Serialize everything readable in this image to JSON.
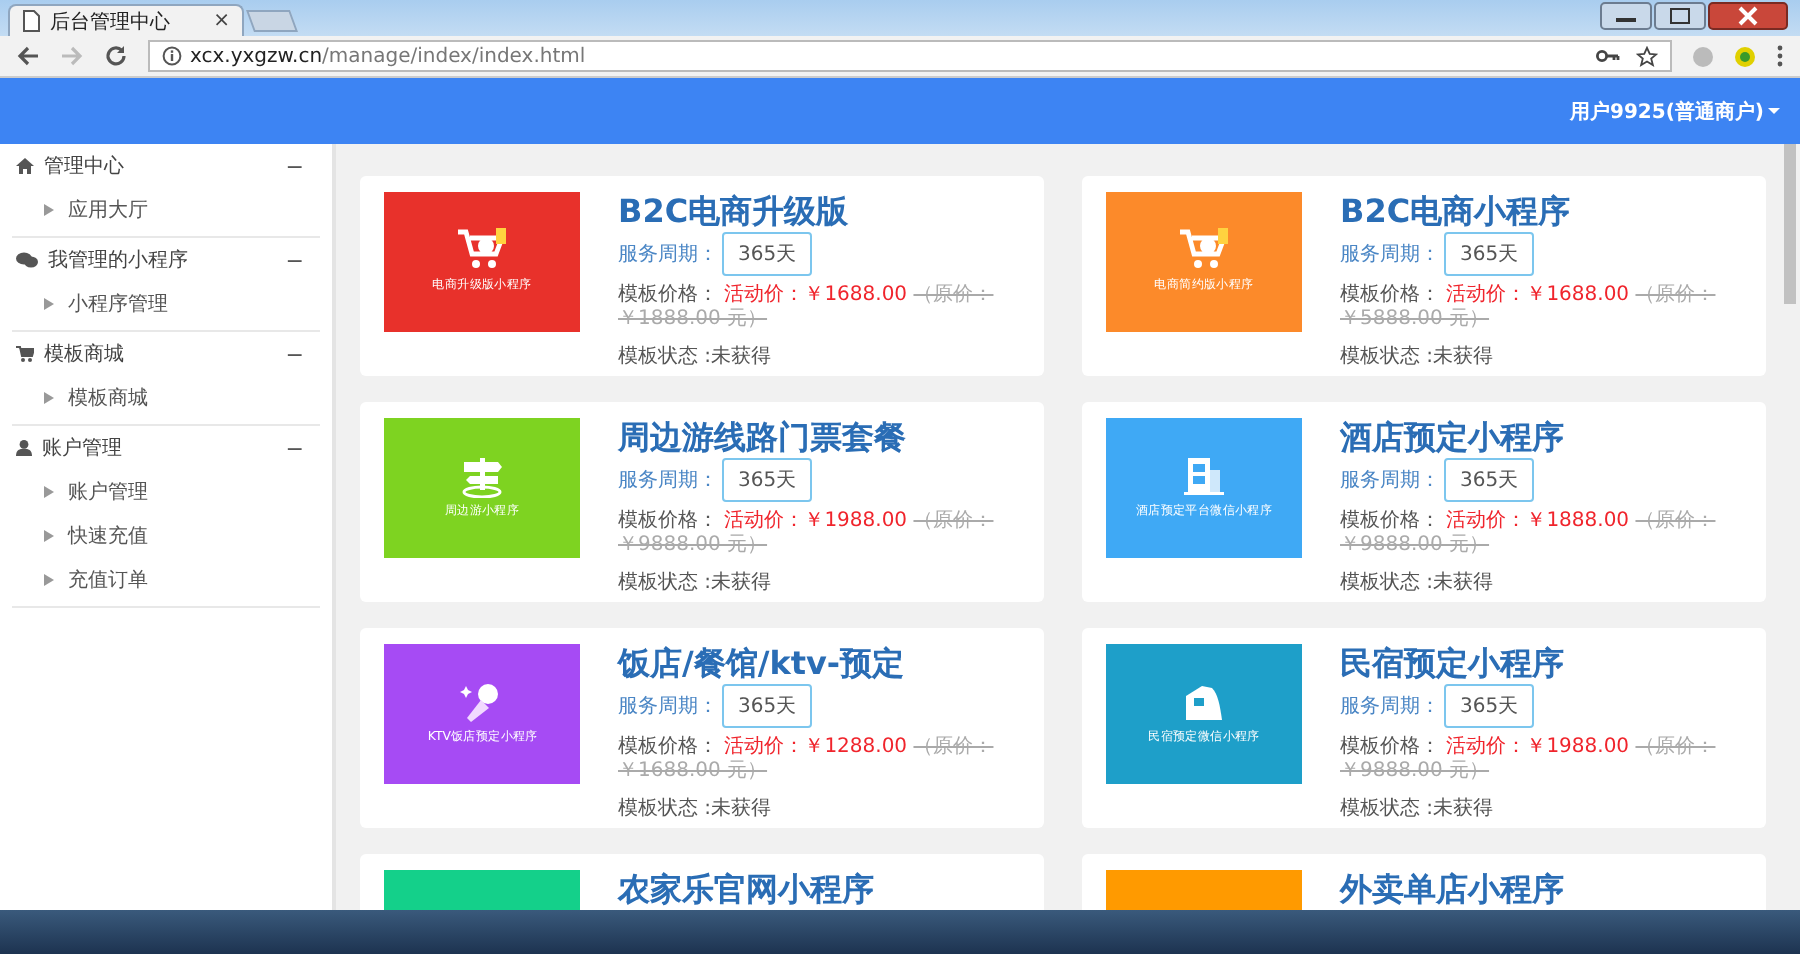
{
  "browser": {
    "tab_title": "后台管理中心",
    "tab_close": "×",
    "url_host": "xcx.yxgzw.cn",
    "url_path": "/manage/index/index.html"
  },
  "header": {
    "user": "用户9925(普通商户)"
  },
  "sidebar": [
    {
      "label": "管理中心",
      "expanded": true,
      "toggle": "−",
      "children": [
        {
          "label": "应用大厅"
        }
      ]
    },
    {
      "label": "我管理的小程序",
      "expanded": true,
      "toggle": "−",
      "children": [
        {
          "label": "小程序管理"
        }
      ]
    },
    {
      "label": "模板商城",
      "expanded": true,
      "toggle": "−",
      "children": [
        {
          "label": "模板商城"
        }
      ]
    },
    {
      "label": "账户管理",
      "expanded": true,
      "toggle": "−",
      "children": [
        {
          "label": "账户管理"
        },
        {
          "label": "快速充值"
        },
        {
          "label": "充值订单"
        }
      ]
    }
  ],
  "cards": [
    {
      "kind": "full",
      "color": "#e8312b",
      "caption": "电商升级版小程序",
      "title": "B2C电商升级版",
      "period_label": "服务周期：",
      "period": "365天",
      "price_label": "模板价格：",
      "sale_price": "活动价：￥1688.00",
      "original_price": "（原价：￥1888.00 元）",
      "status": "模板状态 :未获得"
    },
    {
      "kind": "full",
      "color": "#fc8a2a",
      "caption": "电商简约版小程序",
      "title": "B2C电商小程序",
      "period_label": "服务周期：",
      "period": "365天",
      "price_label": "模板价格：",
      "sale_price": "活动价：￥1688.00",
      "original_price": "（原价：￥5888.00 元）",
      "status": "模板状态 :未获得"
    },
    {
      "kind": "full",
      "color": "#7ed321",
      "caption": "周边游小程序",
      "title": "周边游线路门票套餐",
      "period_label": "服务周期：",
      "period": "365天",
      "price_label": "模板价格：",
      "sale_price": "活动价：￥1988.00",
      "original_price": "（原价：￥9888.00 元）",
      "status": "模板状态 :未获得"
    },
    {
      "kind": "full",
      "color": "#3fa9f5",
      "caption": "酒店预定平台微信小程序",
      "title": "酒店预定小程序",
      "period_label": "服务周期：",
      "period": "365天",
      "price_label": "模板价格：",
      "sale_price": "活动价：￥1888.00",
      "original_price": "（原价：￥9888.00 元）",
      "status": "模板状态 :未获得"
    },
    {
      "kind": "full",
      "color": "#a64bf4",
      "caption": "KTV饭店预定小程序",
      "title": "饭店/餐馆/ktv-预定",
      "period_label": "服务周期：",
      "period": "365天",
      "price_label": "模板价格：",
      "sale_price": "活动价：￥1288.00",
      "original_price": "（原价：￥1688.00 元）",
      "status": "模板状态 :未获得"
    },
    {
      "kind": "full",
      "color": "#1e9fc9",
      "caption": "民宿预定微信小程序",
      "title": "民宿预定小程序",
      "period_label": "服务周期：",
      "period": "365天",
      "price_label": "模板价格：",
      "sale_price": "活动价：￥1988.00",
      "original_price": "（原价：￥9888.00 元）",
      "status": "模板状态 :未获得"
    },
    {
      "kind": "partial",
      "color": "#14d08a",
      "title": "农家乐官网小程序"
    },
    {
      "kind": "partial",
      "color": "#ff9a00",
      "title": "外卖单店小程序"
    }
  ]
}
